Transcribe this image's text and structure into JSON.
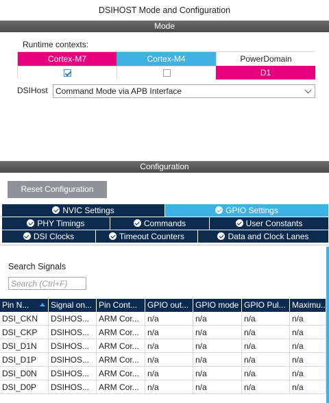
{
  "window": {
    "title": "DSIHOST Mode and Configuration"
  },
  "mode": {
    "header": "Mode",
    "runtime_label": "Runtime contexts:",
    "contexts": [
      "Cortex-M7",
      "Cortex-M4",
      "PowerDomain"
    ],
    "context_checked": [
      true,
      false
    ],
    "power_domain_value": "D1",
    "dsihost_label": "DSIHost",
    "dsihost_value": "Command Mode via APB Interface"
  },
  "config": {
    "header": "Configuration",
    "reset_label": "Reset Configuration",
    "tabs": {
      "nvic": "NVIC Settings",
      "gpio": "GPIO Settings",
      "phy": "PHY Timings",
      "commands": "Commands",
      "user_constants": "User Constants",
      "dsi_clocks": "DSI Clocks",
      "timeout_counters": "Timeout Counters",
      "data_clock_lanes": "Data and Clock Lanes"
    },
    "active_tab": "GPIO Settings",
    "search": {
      "label": "Search Signals",
      "placeholder": "Search (Ctrl+F)"
    },
    "table": {
      "columns": [
        "Pin N...",
        "Signal on...",
        "Pin Cont...",
        "GPIO out...",
        "GPIO mode",
        "GPIO Pul...",
        "Maximu..."
      ],
      "rows": [
        [
          "DSI_CKN",
          "DSIHOS...",
          "ARM Cor...",
          "n/a",
          "n/a",
          "n/a",
          "n/a"
        ],
        [
          "DSI_CKP",
          "DSIHOS...",
          "ARM Cor...",
          "n/a",
          "n/a",
          "n/a",
          "n/a"
        ],
        [
          "DSI_D1N",
          "DSIHOS...",
          "ARM Cor...",
          "n/a",
          "n/a",
          "n/a",
          "n/a"
        ],
        [
          "DSI_D1P",
          "DSIHOS...",
          "ARM Cor...",
          "n/a",
          "n/a",
          "n/a",
          "n/a"
        ],
        [
          "DSI_D0N",
          "DSIHOS...",
          "ARM Cor...",
          "n/a",
          "n/a",
          "n/a",
          "n/a"
        ],
        [
          "DSI_D0P",
          "DSIHOS...",
          "ARM Cor...",
          "n/a",
          "n/a",
          "n/a",
          "n/a"
        ]
      ]
    }
  },
  "colors": {
    "magenta": "#e6007e",
    "cyan": "#3fb1e3",
    "navy": "#0d2a4f",
    "gray_button": "#8f9296"
  }
}
